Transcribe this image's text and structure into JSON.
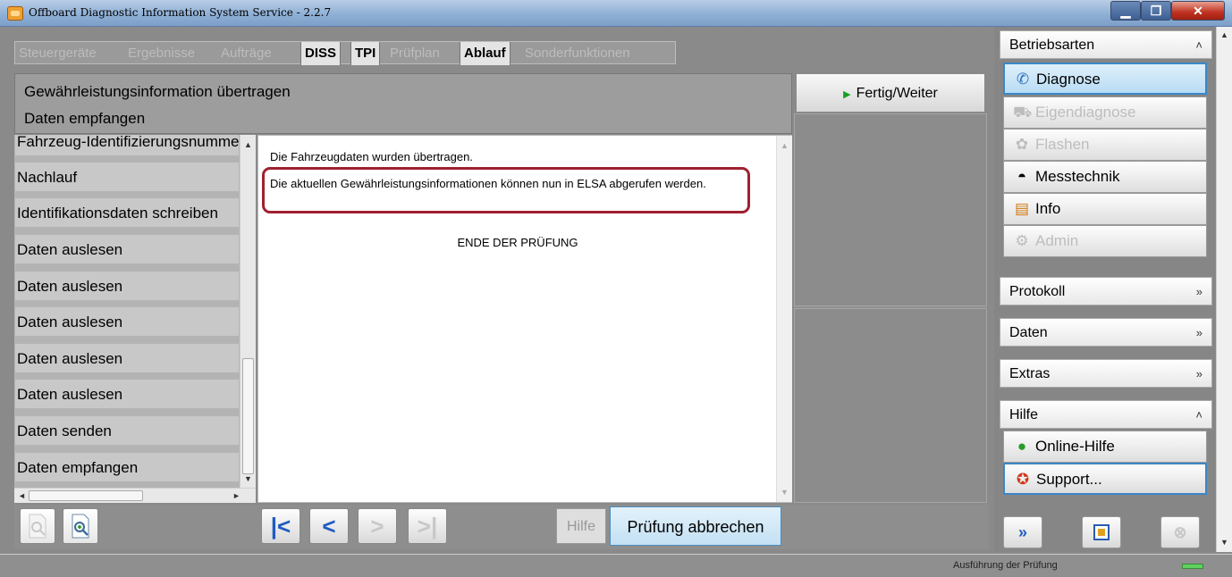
{
  "window": {
    "title": "Offboard Diagnostic Information System Service - 2.2.7",
    "min": "▁",
    "max": "❐",
    "close": "✕"
  },
  "tabs": [
    {
      "label": "Steuergeräte",
      "state": "disabled"
    },
    {
      "label": "Ergebnisse",
      "state": "disabled"
    },
    {
      "label": "Aufträge",
      "state": "disabled"
    },
    {
      "label": "DISS",
      "state": "enabled"
    },
    {
      "label": "TPI",
      "state": "enabled"
    },
    {
      "label": "Prüfplan",
      "state": "disabled"
    },
    {
      "label": "Ablauf",
      "state": "active"
    },
    {
      "label": "Sonderfunktionen",
      "state": "disabled"
    }
  ],
  "header": {
    "line1": "Gewährleistungsinformation übertragen",
    "line2": "Daten empfangen",
    "next_button": "Fertig/Weiter"
  },
  "step_list": [
    "Fahrzeug-Identifizierungsnummer",
    "Nachlauf",
    "Identifikationsdaten schreiben",
    "Daten auslesen",
    "Daten auslesen",
    "Daten auslesen",
    "Daten auslesen",
    "Daten auslesen",
    "Daten senden",
    "Daten empfangen"
  ],
  "scroll": {
    "up": "▲",
    "down": "▼",
    "left": "◄",
    "right": "►"
  },
  "content": {
    "line1": "Die Fahrzeugdaten wurden übertragen.",
    "line2": "Die aktuellen Gewährleistungsinformationen können nun in ELSA abgerufen werden.",
    "line3": "ENDE DER PRÜFUNG"
  },
  "toolbar": {
    "nav_first": "|<",
    "nav_prev": "<",
    "nav_next": ">",
    "nav_last": ">|",
    "help": "Hilfe",
    "abort": "Prüfung abbrechen"
  },
  "right_panel": {
    "betriebsarten": {
      "label": "Betriebsarten",
      "items": [
        {
          "label": "Diagnose",
          "icon": "stethoscope-icon",
          "state": "selected"
        },
        {
          "label": "Eigendiagnose",
          "icon": "car-icon",
          "state": "disabled"
        },
        {
          "label": "Flashen",
          "icon": "flash-icon",
          "state": "disabled"
        },
        {
          "label": "Messtechnik",
          "icon": "gauge-icon",
          "state": "enabled"
        },
        {
          "label": "Info",
          "icon": "book-icon",
          "state": "enabled"
        },
        {
          "label": "Admin",
          "icon": "admin-icon",
          "state": "disabled"
        }
      ]
    },
    "protokoll": "Protokoll",
    "daten": "Daten",
    "extras": "Extras",
    "hilfe": {
      "label": "Hilfe",
      "items": [
        {
          "label": "Online-Hilfe",
          "icon": "help-icon"
        },
        {
          "label": "Support...",
          "icon": "lifebuoy-icon"
        }
      ]
    }
  },
  "status": {
    "text": "Ausführung der Prüfung"
  },
  "colors": {
    "highlight_border": "#a02030",
    "selected_blue": "#3a88c8",
    "nav_arrow": "#1f5bc0"
  }
}
